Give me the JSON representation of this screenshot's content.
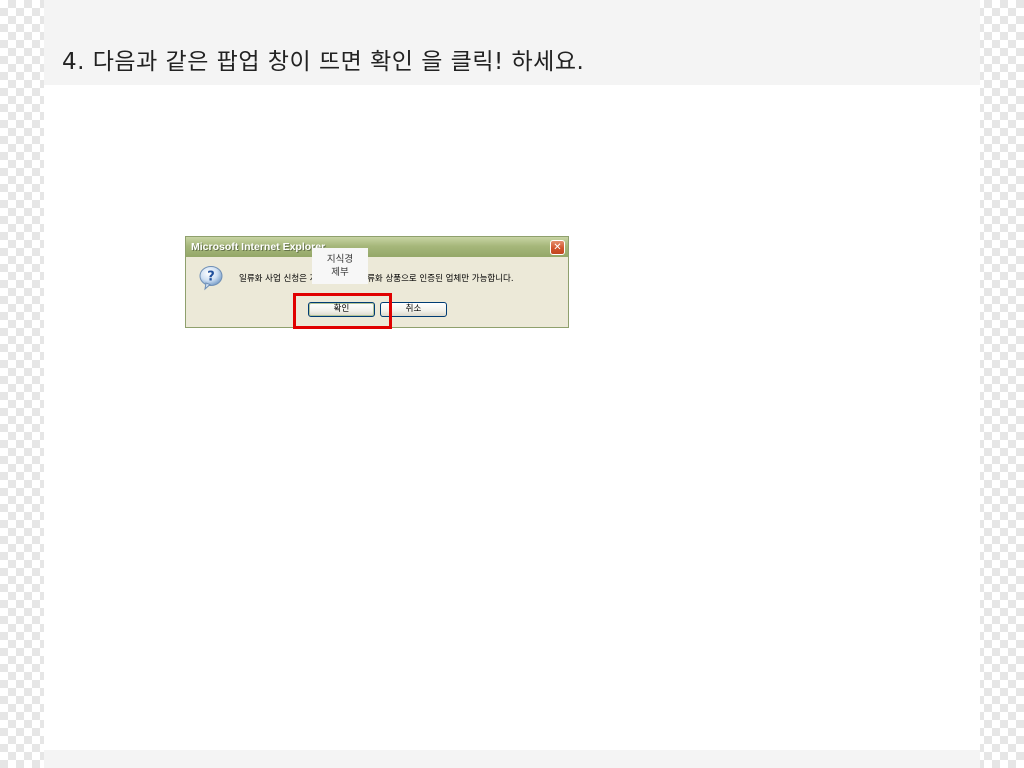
{
  "slide": {
    "title": "4. 다음과 같은 팝업 창이 뜨면 확인 을 클릭! 하세요."
  },
  "dialog": {
    "title": "Microsoft Internet Explorer",
    "close_glyph": "✕",
    "icon": "question-icon",
    "message": "일류화 사업 신청은 지식경제부로 인류화 상품으로 인증된 업체만 가능합니다.",
    "ok_label": "확인",
    "cancel_label": "취소"
  },
  "tooltip": {
    "line1": "지식경",
    "line2": "제부"
  },
  "colors": {
    "highlight": "#e00000",
    "titlebar": "#a6b77b",
    "dialog_bg": "#ece9d8"
  }
}
